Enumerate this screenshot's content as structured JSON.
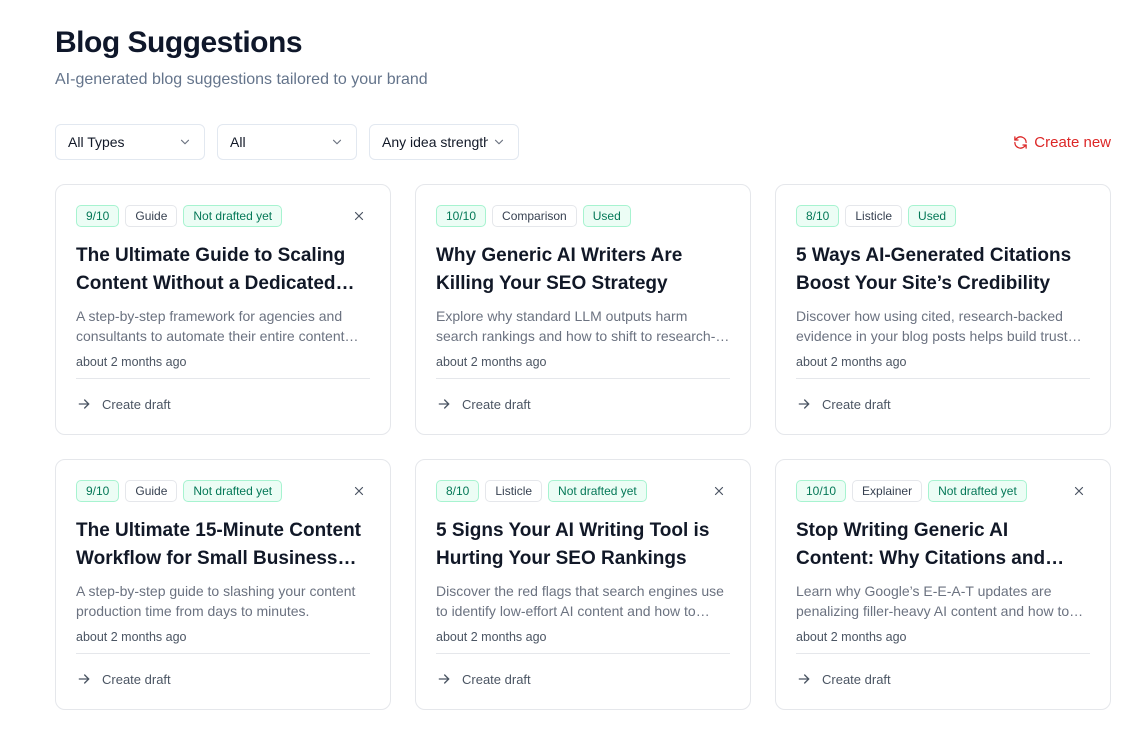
{
  "header": {
    "title": "Blog Suggestions",
    "subtitle": "AI-generated blog suggestions tailored to your brand"
  },
  "filters": {
    "type": "All Types",
    "status": "All",
    "strength": "Any idea strength"
  },
  "actions": {
    "create_new": "Create new"
  },
  "colors": {
    "accent_red": "#dc2626",
    "badge_green_bg": "#ecfdf5",
    "badge_green_text": "#047857"
  },
  "cards": [
    {
      "score": "9/10",
      "type": "Guide",
      "status": "Not drafted yet",
      "dismissable": true,
      "title": "The Ultimate Guide to Scaling Content Without a Dedicated Writing Team",
      "description": "A step-by-step framework for agencies and consultants to automate their entire content pipeline.",
      "time": "about 2 months ago",
      "action": "Create draft"
    },
    {
      "score": "10/10",
      "type": "Comparison",
      "status": "Used",
      "dismissable": false,
      "title": "Why Generic AI Writers Are Killing Your SEO Strategy",
      "description": "Explore why standard LLM outputs harm search rankings and how to shift to research-backed content.",
      "time": "about 2 months ago",
      "action": "Create draft"
    },
    {
      "score": "8/10",
      "type": "Listicle",
      "status": "Used",
      "dismissable": false,
      "title": "5 Ways AI-Generated Citations Boost Your Site’s Credibility",
      "description": "Discover how using cited, research-backed evidence in your blog posts helps build trust with readers.",
      "time": "about 2 months ago",
      "action": "Create draft"
    },
    {
      "score": "9/10",
      "type": "Guide",
      "status": "Not drafted yet",
      "dismissable": true,
      "title": "The Ultimate 15-Minute Content Workflow for Small Business Owners",
      "description": "A step-by-step guide to slashing your content production time from days to minutes.",
      "time": "about 2 months ago",
      "action": "Create draft"
    },
    {
      "score": "8/10",
      "type": "Listicle",
      "status": "Not drafted yet",
      "dismissable": true,
      "title": "5 Signs Your AI Writing Tool is Hurting Your SEO Rankings",
      "description": "Discover the red flags that search engines use to identify low-effort AI content and how to avoid them.",
      "time": "about 2 months ago",
      "action": "Create draft"
    },
    {
      "score": "10/10",
      "type": "Explainer",
      "status": "Not drafted yet",
      "dismissable": true,
      "title": "Stop Writing Generic AI Content: Why Citations and SEO Data Matter",
      "description": "Learn why Google’s E-E-A-T updates are penalizing filler-heavy AI content and how to stay ahead.",
      "time": "about 2 months ago",
      "action": "Create draft"
    }
  ]
}
